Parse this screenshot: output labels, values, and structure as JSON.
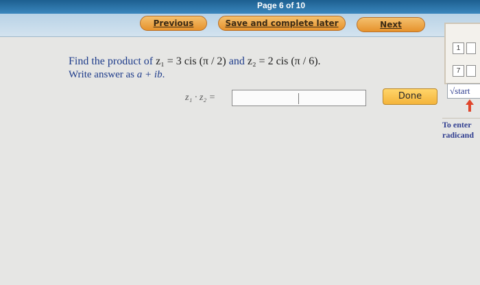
{
  "header": {
    "page_indicator": "Page 6 of 10"
  },
  "nav": {
    "previous_label": "Previous",
    "save_label": "Save and complete later",
    "next_label": "Next"
  },
  "question": {
    "prompt_prefix": "Find the product of ",
    "z1_expr": "z₁ = 3 cis (π / 2)",
    "and_text": " and ",
    "z2_expr": "z₂ = 2 cis (π / 6).",
    "line2_prefix": "Write answer as ",
    "answer_form": "a + ib",
    "line2_suffix": "."
  },
  "answer": {
    "label": "z₁ · z₂ =",
    "value": ""
  },
  "done_label": "Done",
  "palette": {
    "keys": [
      "1",
      "7"
    ]
  },
  "sqrt_label": "√start",
  "hint_text": [
    "To enter",
    "radicand"
  ],
  "colors": {
    "nav_pill": "#e6922c",
    "done_button": "#f4b43a",
    "question_text": "#1d3b8a",
    "top_band": "#1d5f90"
  }
}
